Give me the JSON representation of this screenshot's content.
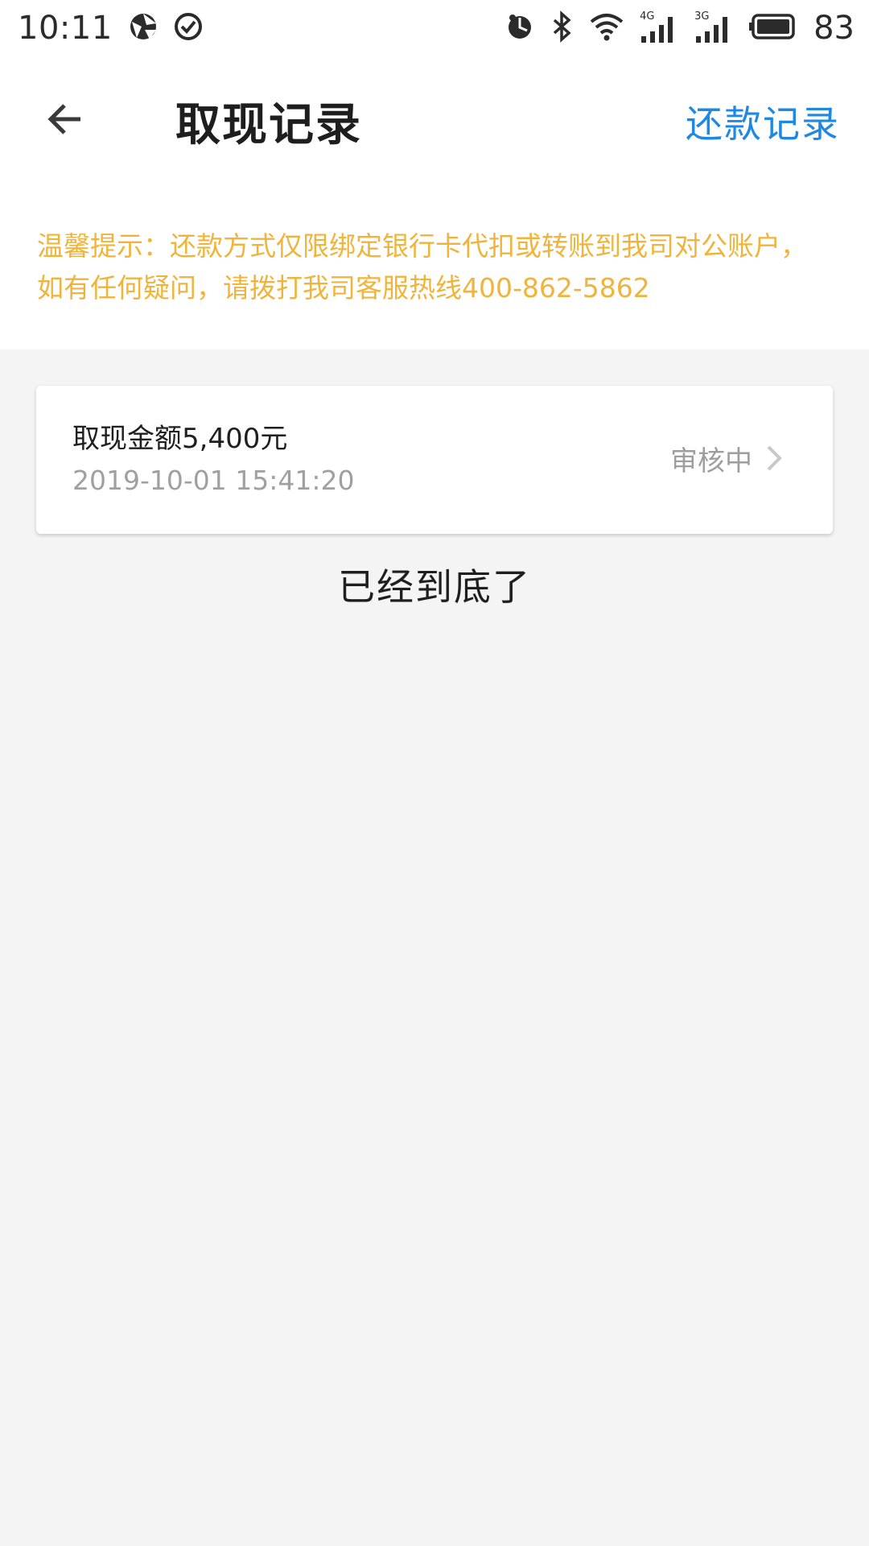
{
  "status_bar": {
    "time": "10:11",
    "battery_level": "83",
    "network_4g": "4G",
    "network_3g": "3G",
    "icons": [
      "aperture-icon",
      "check-circle-icon",
      "alarm-icon",
      "bluetooth-icon",
      "wifi-icon",
      "signal-4g-icon",
      "signal-3g-icon",
      "battery-icon"
    ]
  },
  "header": {
    "title": "取现记录",
    "repay_link": "还款记录",
    "back_icon": "arrow-left-icon"
  },
  "notice": {
    "text": "温馨提示：还款方式仅限绑定银行卡代扣或转账到我司对公账户， 如有任何疑问，请拨打我司客服热线400-862-5862"
  },
  "records": [
    {
      "amount_label": "取现金额5,400元",
      "time": "2019-10-01 15:41:20",
      "status": "审核中"
    }
  ],
  "list_end": "已经到底了",
  "colors": {
    "accent": "#1e88e5",
    "notice": "#f0b43a",
    "background": "#f4f4f4"
  }
}
